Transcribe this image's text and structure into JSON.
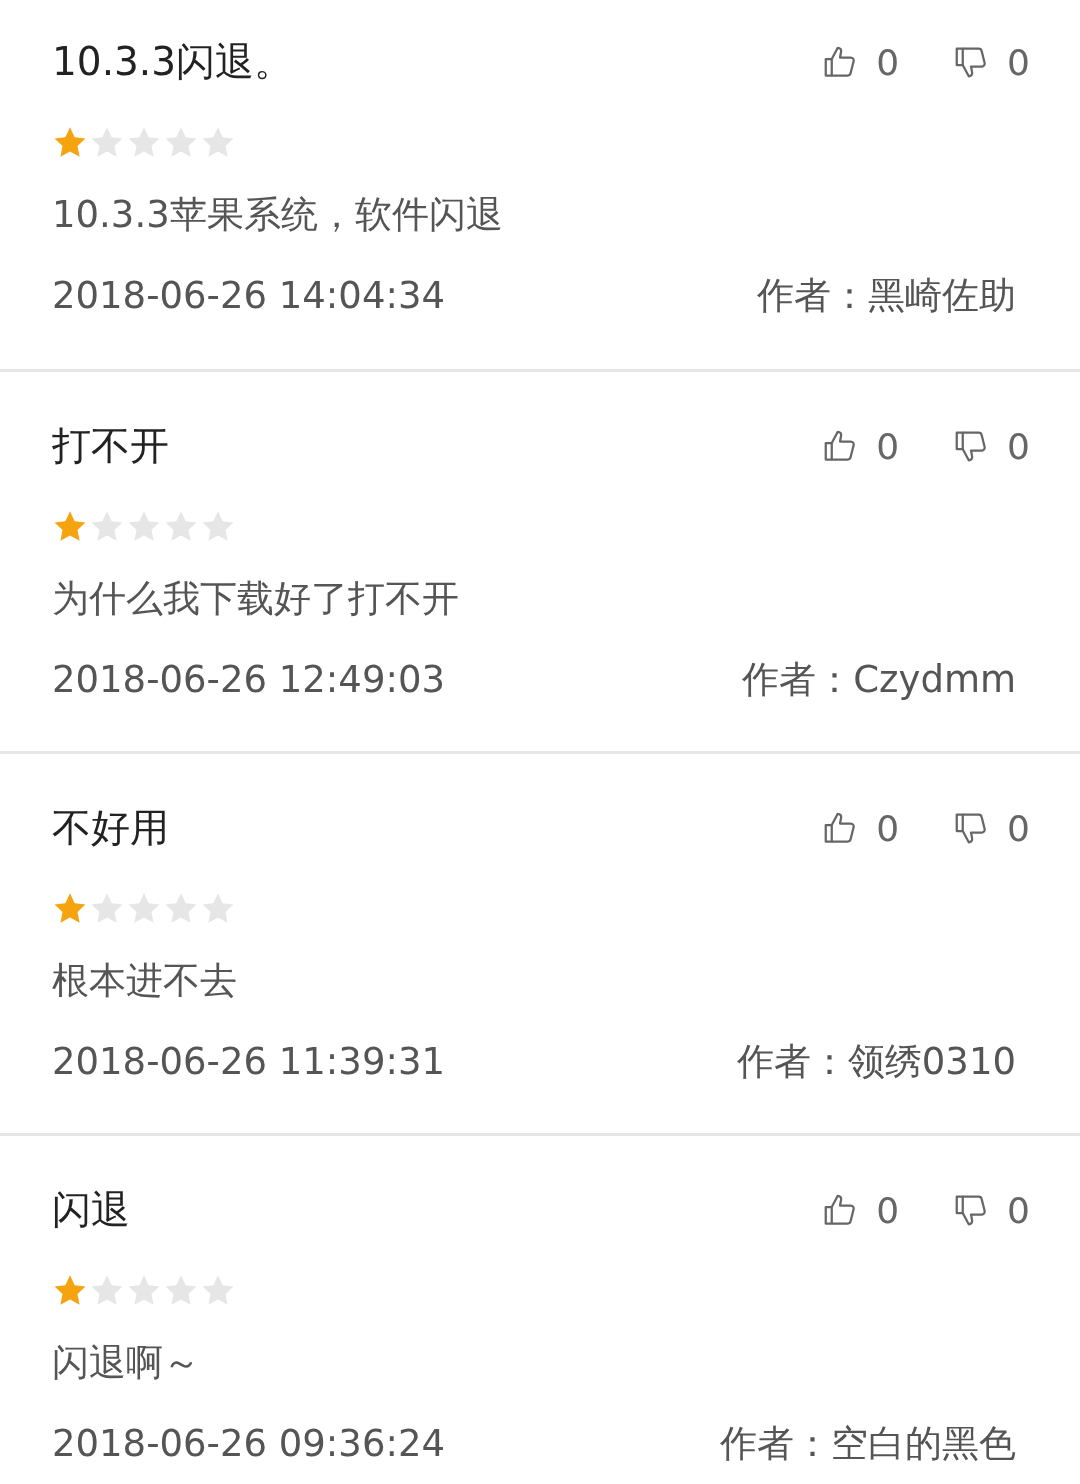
{
  "reviews": [
    {
      "title": "10.3.3闪退。",
      "likes": "0",
      "dislikes": "0",
      "stars": 1,
      "body": "10.3.3苹果系统，软件闪退",
      "date": "2018-06-26 14:04:34",
      "author": "作者：黑崎佐助"
    },
    {
      "title": "打不开",
      "likes": "0",
      "dislikes": "0",
      "stars": 1,
      "body": "为什么我下载好了打不开",
      "date": "2018-06-26 12:49:03",
      "author": "作者：Czydmm"
    },
    {
      "title": "不好用",
      "likes": "0",
      "dislikes": "0",
      "stars": 1,
      "body": "根本进不去",
      "date": "2018-06-26 11:39:31",
      "author": "作者：领绣0310"
    },
    {
      "title": "闪退",
      "likes": "0",
      "dislikes": "0",
      "stars": 1,
      "body": "闪退啊～",
      "date": "2018-06-26 09:36:24",
      "author": "作者：空白的黑色"
    }
  ]
}
